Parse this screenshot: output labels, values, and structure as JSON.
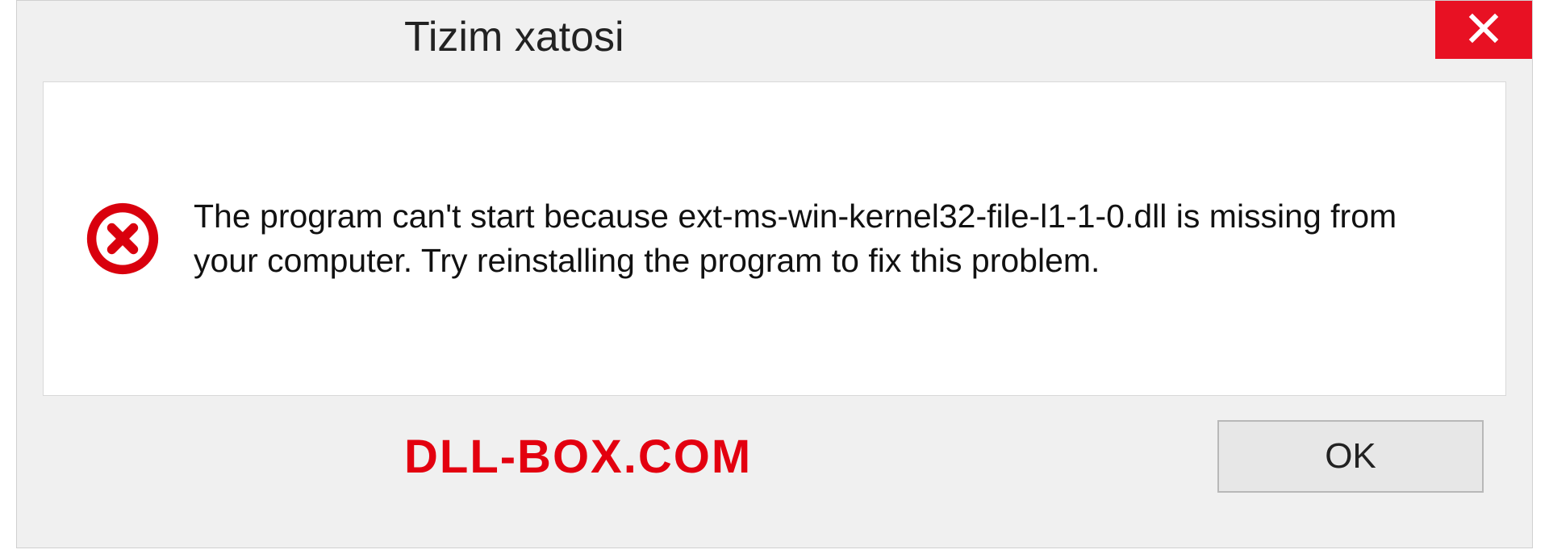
{
  "dialog": {
    "title": "Tizim xatosi",
    "message": "The program can't start because ext-ms-win-kernel32-file-l1-1-0.dll is missing from your computer. Try reinstalling the program to fix this problem.",
    "ok_label": "OK",
    "watermark": "DLL-BOX.COM"
  },
  "icons": {
    "close": "close-icon",
    "error": "error-circle-x-icon"
  },
  "colors": {
    "close_bg": "#e81123",
    "error_red": "#d9000d",
    "watermark_red": "#e3000f",
    "panel_bg": "#f0f0f0"
  }
}
